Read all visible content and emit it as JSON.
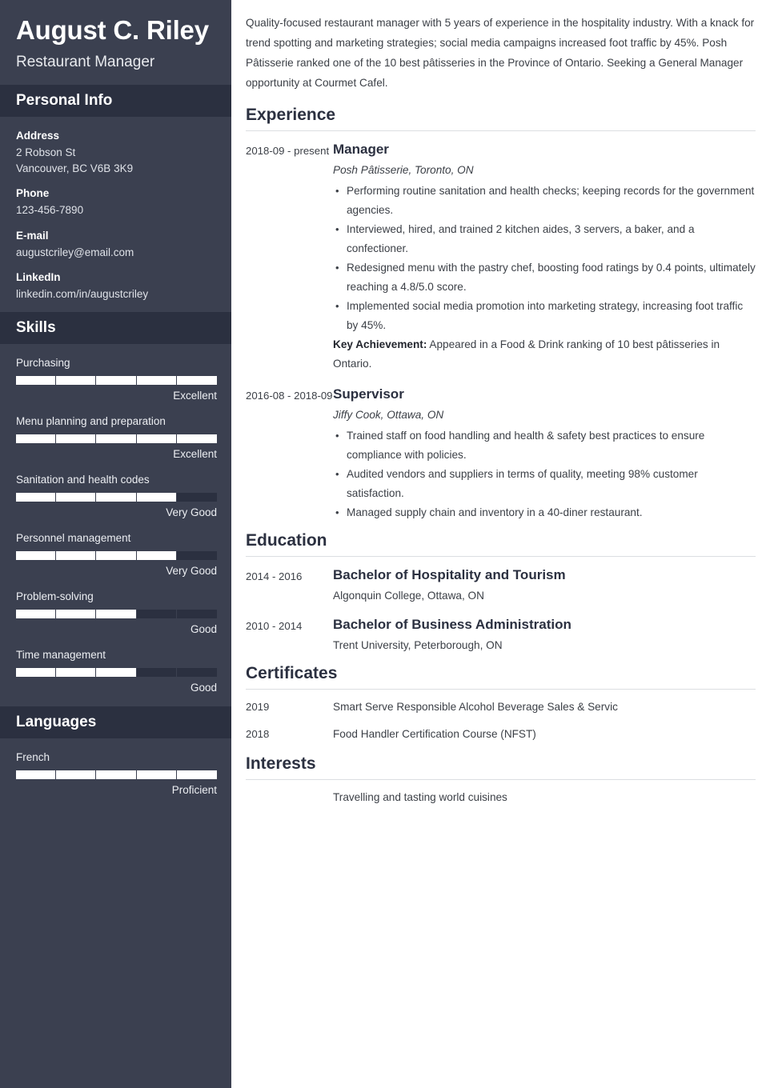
{
  "sidebar": {
    "full_name": "August C. Riley",
    "job_title": "Restaurant Manager",
    "personal_info": {
      "heading": "Personal Info",
      "items": [
        {
          "label": "Address",
          "lines": [
            "2 Robson St",
            "Vancouver, BC V6B 3K9"
          ]
        },
        {
          "label": "Phone",
          "lines": [
            "123-456-7890"
          ]
        },
        {
          "label": "E-mail",
          "lines": [
            "augustcriley@email.com"
          ]
        },
        {
          "label": "LinkedIn",
          "lines": [
            "linkedin.com/in/augustcriley"
          ]
        }
      ]
    },
    "skills": {
      "heading": "Skills",
      "items": [
        {
          "name": "Purchasing",
          "level": "Excellent",
          "filled": 5,
          "total": 5
        },
        {
          "name": "Menu planning and preparation",
          "level": "Excellent",
          "filled": 5,
          "total": 5
        },
        {
          "name": "Sanitation and health codes",
          "level": "Very Good",
          "filled": 4,
          "total": 5
        },
        {
          "name": "Personnel management",
          "level": "Very Good",
          "filled": 4,
          "total": 5
        },
        {
          "name": "Problem-solving",
          "level": "Good",
          "filled": 3,
          "total": 5
        },
        {
          "name": "Time management",
          "level": "Good",
          "filled": 3,
          "total": 5
        }
      ]
    },
    "languages": {
      "heading": "Languages",
      "items": [
        {
          "name": "French",
          "level": "Proficient",
          "filled": 5,
          "total": 5
        }
      ]
    }
  },
  "main": {
    "summary": "Quality-focused restaurant manager with 5 years of experience in the hospitality industry. With a knack for trend spotting and marketing strategies; social media campaigns increased foot traffic by 45%. Posh Pâtisserie ranked one of the 10 best pâtisseries in the Province of Ontario. Seeking a General Manager opportunity at Courmet Cafel.",
    "experience": {
      "heading": "Experience",
      "entries": [
        {
          "dates": "2018-09 - present",
          "role": "Manager",
          "org": "Posh Pâtisserie, Toronto, ON",
          "bullets": [
            "Performing routine sanitation and health checks; keeping records for the government agencies.",
            "Interviewed, hired, and trained 2 kitchen aides, 3 servers, a baker, and a confectioner.",
            "Redesigned menu with the pastry chef, boosting food ratings by 0.4 points, ultimately reaching a 4.8/5.0 score.",
            "Implemented social media promotion into marketing strategy, increasing foot traffic by 45%."
          ],
          "key_achievement_label": "Key Achievement:",
          "key_achievement_text": " Appeared in a Food & Drink ranking of 10 best pâtisseries in Ontario."
        },
        {
          "dates": "2016-08 - 2018-09",
          "role": "Supervisor",
          "org": "Jiffy Cook, Ottawa, ON",
          "bullets": [
            "Trained staff on food handling and health & safety best practices to ensure compliance with policies.",
            "Audited vendors and suppliers in terms of quality, meeting 98% customer satisfaction.",
            "Managed supply chain and inventory in a 40-diner restaurant."
          ],
          "key_achievement_label": "",
          "key_achievement_text": ""
        }
      ]
    },
    "education": {
      "heading": "Education",
      "entries": [
        {
          "dates": "2014 - 2016",
          "degree": "Bachelor of Hospitality and Tourism",
          "school": "Algonquin College, Ottawa, ON"
        },
        {
          "dates": "2010 - 2014",
          "degree": "Bachelor of Business Administration",
          "school": "Trent University, Peterborough, ON"
        }
      ]
    },
    "certificates": {
      "heading": "Certificates",
      "entries": [
        {
          "year": "2019",
          "name": "Smart Serve Responsible Alcohol Beverage Sales & Servic"
        },
        {
          "year": "2018",
          "name": "Food Handler Certification Course (NFST)"
        }
      ]
    },
    "interests": {
      "heading": "Interests",
      "entries": [
        {
          "text": "Travelling and tasting world cuisines"
        }
      ]
    }
  },
  "colors": {
    "sidebar_bg": "#3b4050",
    "sidebar_band_bg": "#2b3040",
    "bar_fill": "#ffffff",
    "text_dark": "#3c4047",
    "rule": "#dcdee2"
  }
}
